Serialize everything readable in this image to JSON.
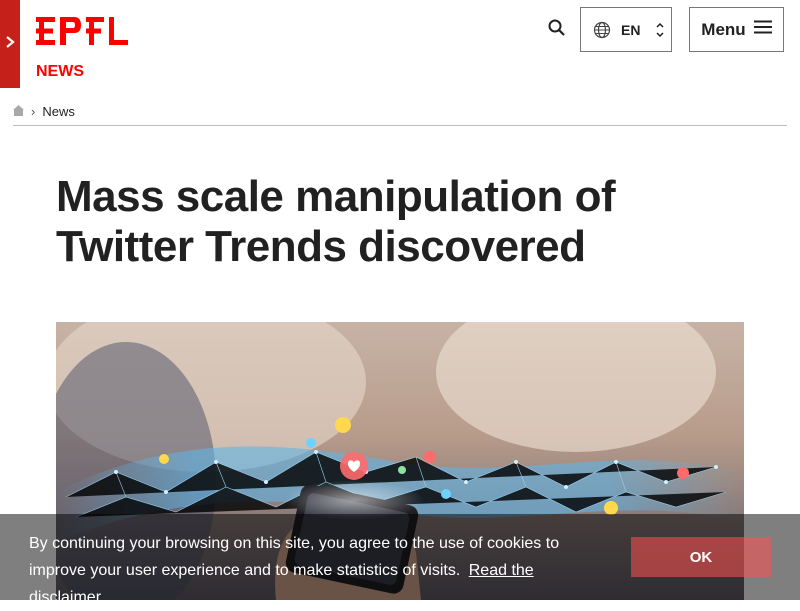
{
  "brand": {
    "logo_text": "EPFL",
    "color": "#ff0000"
  },
  "header": {
    "section_label": "NEWS",
    "language": {
      "selected": "EN"
    },
    "menu_label": "Menu"
  },
  "breadcrumb": {
    "items": [
      "News"
    ]
  },
  "article": {
    "title": "Mass scale manipulation of Twitter Trends discovered"
  },
  "cookie_banner": {
    "text": "By continuing your browsing on this site, you agree to the use of cookies to improve your user experience and to make statistics of visits.",
    "link_label": "Read the disclaimer",
    "ok_label": "OK"
  },
  "icons": {
    "sidebar_toggle": "chevron-right-icon",
    "search": "search-icon",
    "language": "globe-icon",
    "menu": "hamburger-icon",
    "home": "home-icon"
  }
}
